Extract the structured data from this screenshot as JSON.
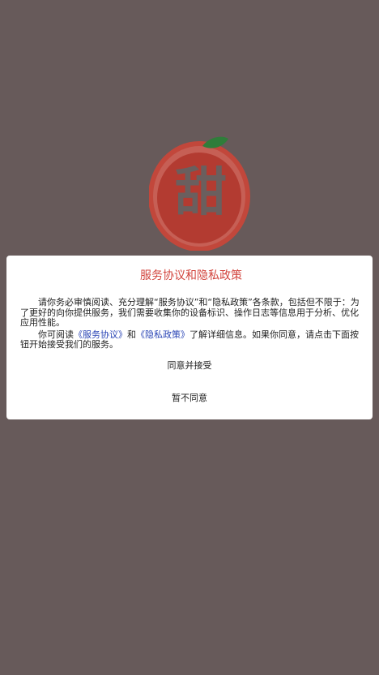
{
  "app_logo": {
    "character": "甜",
    "colors": {
      "ring": "#c2473b",
      "inner": "#b33b31",
      "leaf": "#2f7d3a",
      "character": "#6a5f5e"
    }
  },
  "dialog": {
    "title": "服务协议和隐私政策",
    "paragraph1": "请你务必审慎阅读、充分理解“服务协议”和“隐私政策”各条款，包括但不限于：为了更好的向你提供服务，我们需要收集你的设备标识、操作日志等信息用于分析、优化应用性能。",
    "paragraph2_prefix": "你可阅读",
    "service_agreement_link": "《服务协议》",
    "paragraph2_and": "和",
    "privacy_policy_link": "《隐私政策》",
    "paragraph2_suffix": "了解详细信息。如果你同意，请点击下面按钮开始接受我们的服务。",
    "agree_button": "同意并接受",
    "disagree_button": "暂不同意"
  },
  "colors": {
    "overlay_background": "#675a5a",
    "title_red": "#d2453e",
    "link_blue": "#2a45b5"
  }
}
